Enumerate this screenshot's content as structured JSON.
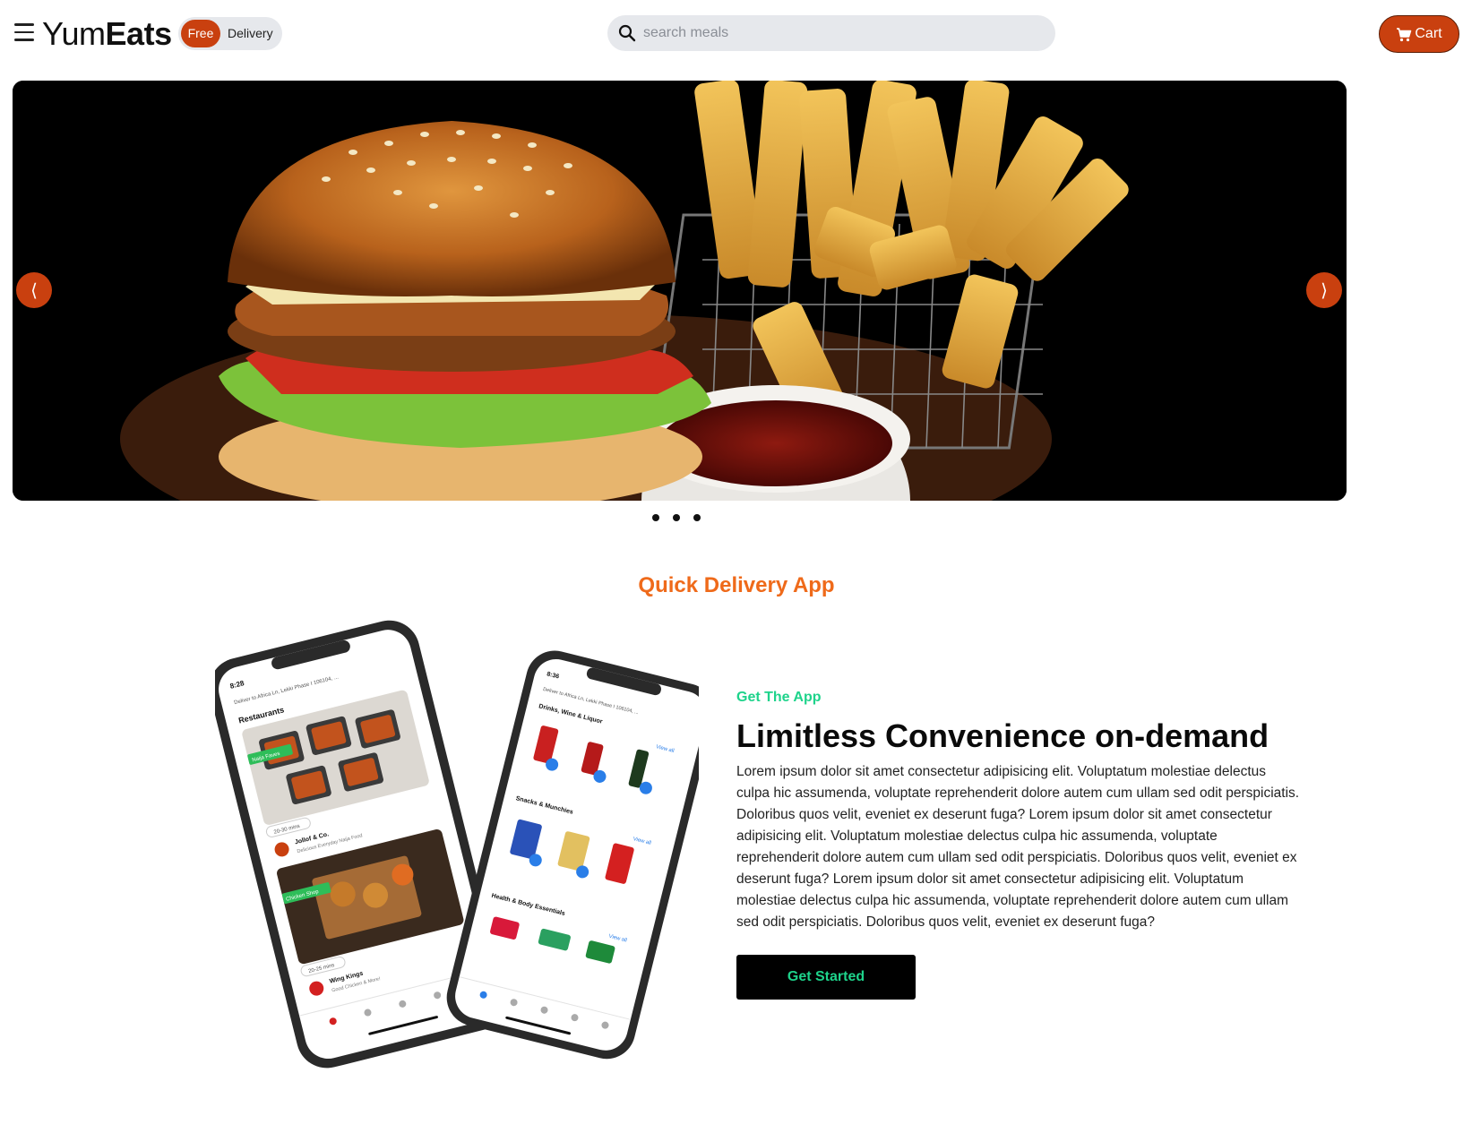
{
  "header": {
    "logo_part1": "Yum",
    "logo_part2": "Eats",
    "free_badge": "Free",
    "delivery_label": "Delivery",
    "search_placeholder": "search meals",
    "cart_label": "Cart"
  },
  "carousel": {
    "prev_glyph": "⟨",
    "next_glyph": "⟩",
    "slide_count": 3
  },
  "section": {
    "title": "Quick Delivery App",
    "eyebrow": "Get The App",
    "headline": "Limitless Convenience on-demand",
    "body": "Lorem ipsum dolor sit amet consectetur adipisicing elit. Voluptatum molestiae delectus culpa hic assumenda, voluptate reprehenderit dolore autem cum ullam sed odit perspiciatis. Doloribus quos velit, eveniet ex deserunt fuga? Lorem ipsum dolor sit amet consectetur adipisicing elit. Voluptatum molestiae delectus culpa hic assumenda, voluptate reprehenderit dolore autem cum ullam sed odit perspiciatis. Doloribus quos velit, eveniet ex deserunt fuga? Lorem ipsum dolor sit amet consectetur adipisicing elit. Voluptatum molestiae delectus culpa hic assumenda, voluptate reprehenderit dolore autem cum ullam sed odit perspiciatis. Doloribus quos velit, eveniet ex deserunt fuga?",
    "cta_label": "Get Started"
  },
  "phone_left": {
    "time": "8:28",
    "deliver_to": "Deliver to Africa Ln, Lekki Phase I 106104, ...",
    "section": "Restaurants",
    "tag1": "Naija Faves",
    "eta1": "20-30 mins",
    "name1": "Jollof & Co.",
    "sub1": "Delicious Everyday Naija Food",
    "tag2": "Chicken Shop",
    "eta2": "20-25 mins",
    "name2": "Wing Kings",
    "sub2": "Good Chicken & More!"
  },
  "phone_right": {
    "time": "8:36",
    "deliver_to": "Deliver to Africa Ln, Lekki Phase I 106104, ...",
    "section1": "Drinks, Wine & Liquor",
    "section2": "Snacks & Munchies",
    "section3": "Health & Body Essentials",
    "view_all": "View all"
  },
  "colors": {
    "brand": "#c9400f",
    "accent_orange": "#ef6a1a",
    "accent_green": "#1ed38b"
  },
  "icons": {
    "menu": "hamburger-icon",
    "search": "search-icon",
    "cart": "cart-icon"
  }
}
